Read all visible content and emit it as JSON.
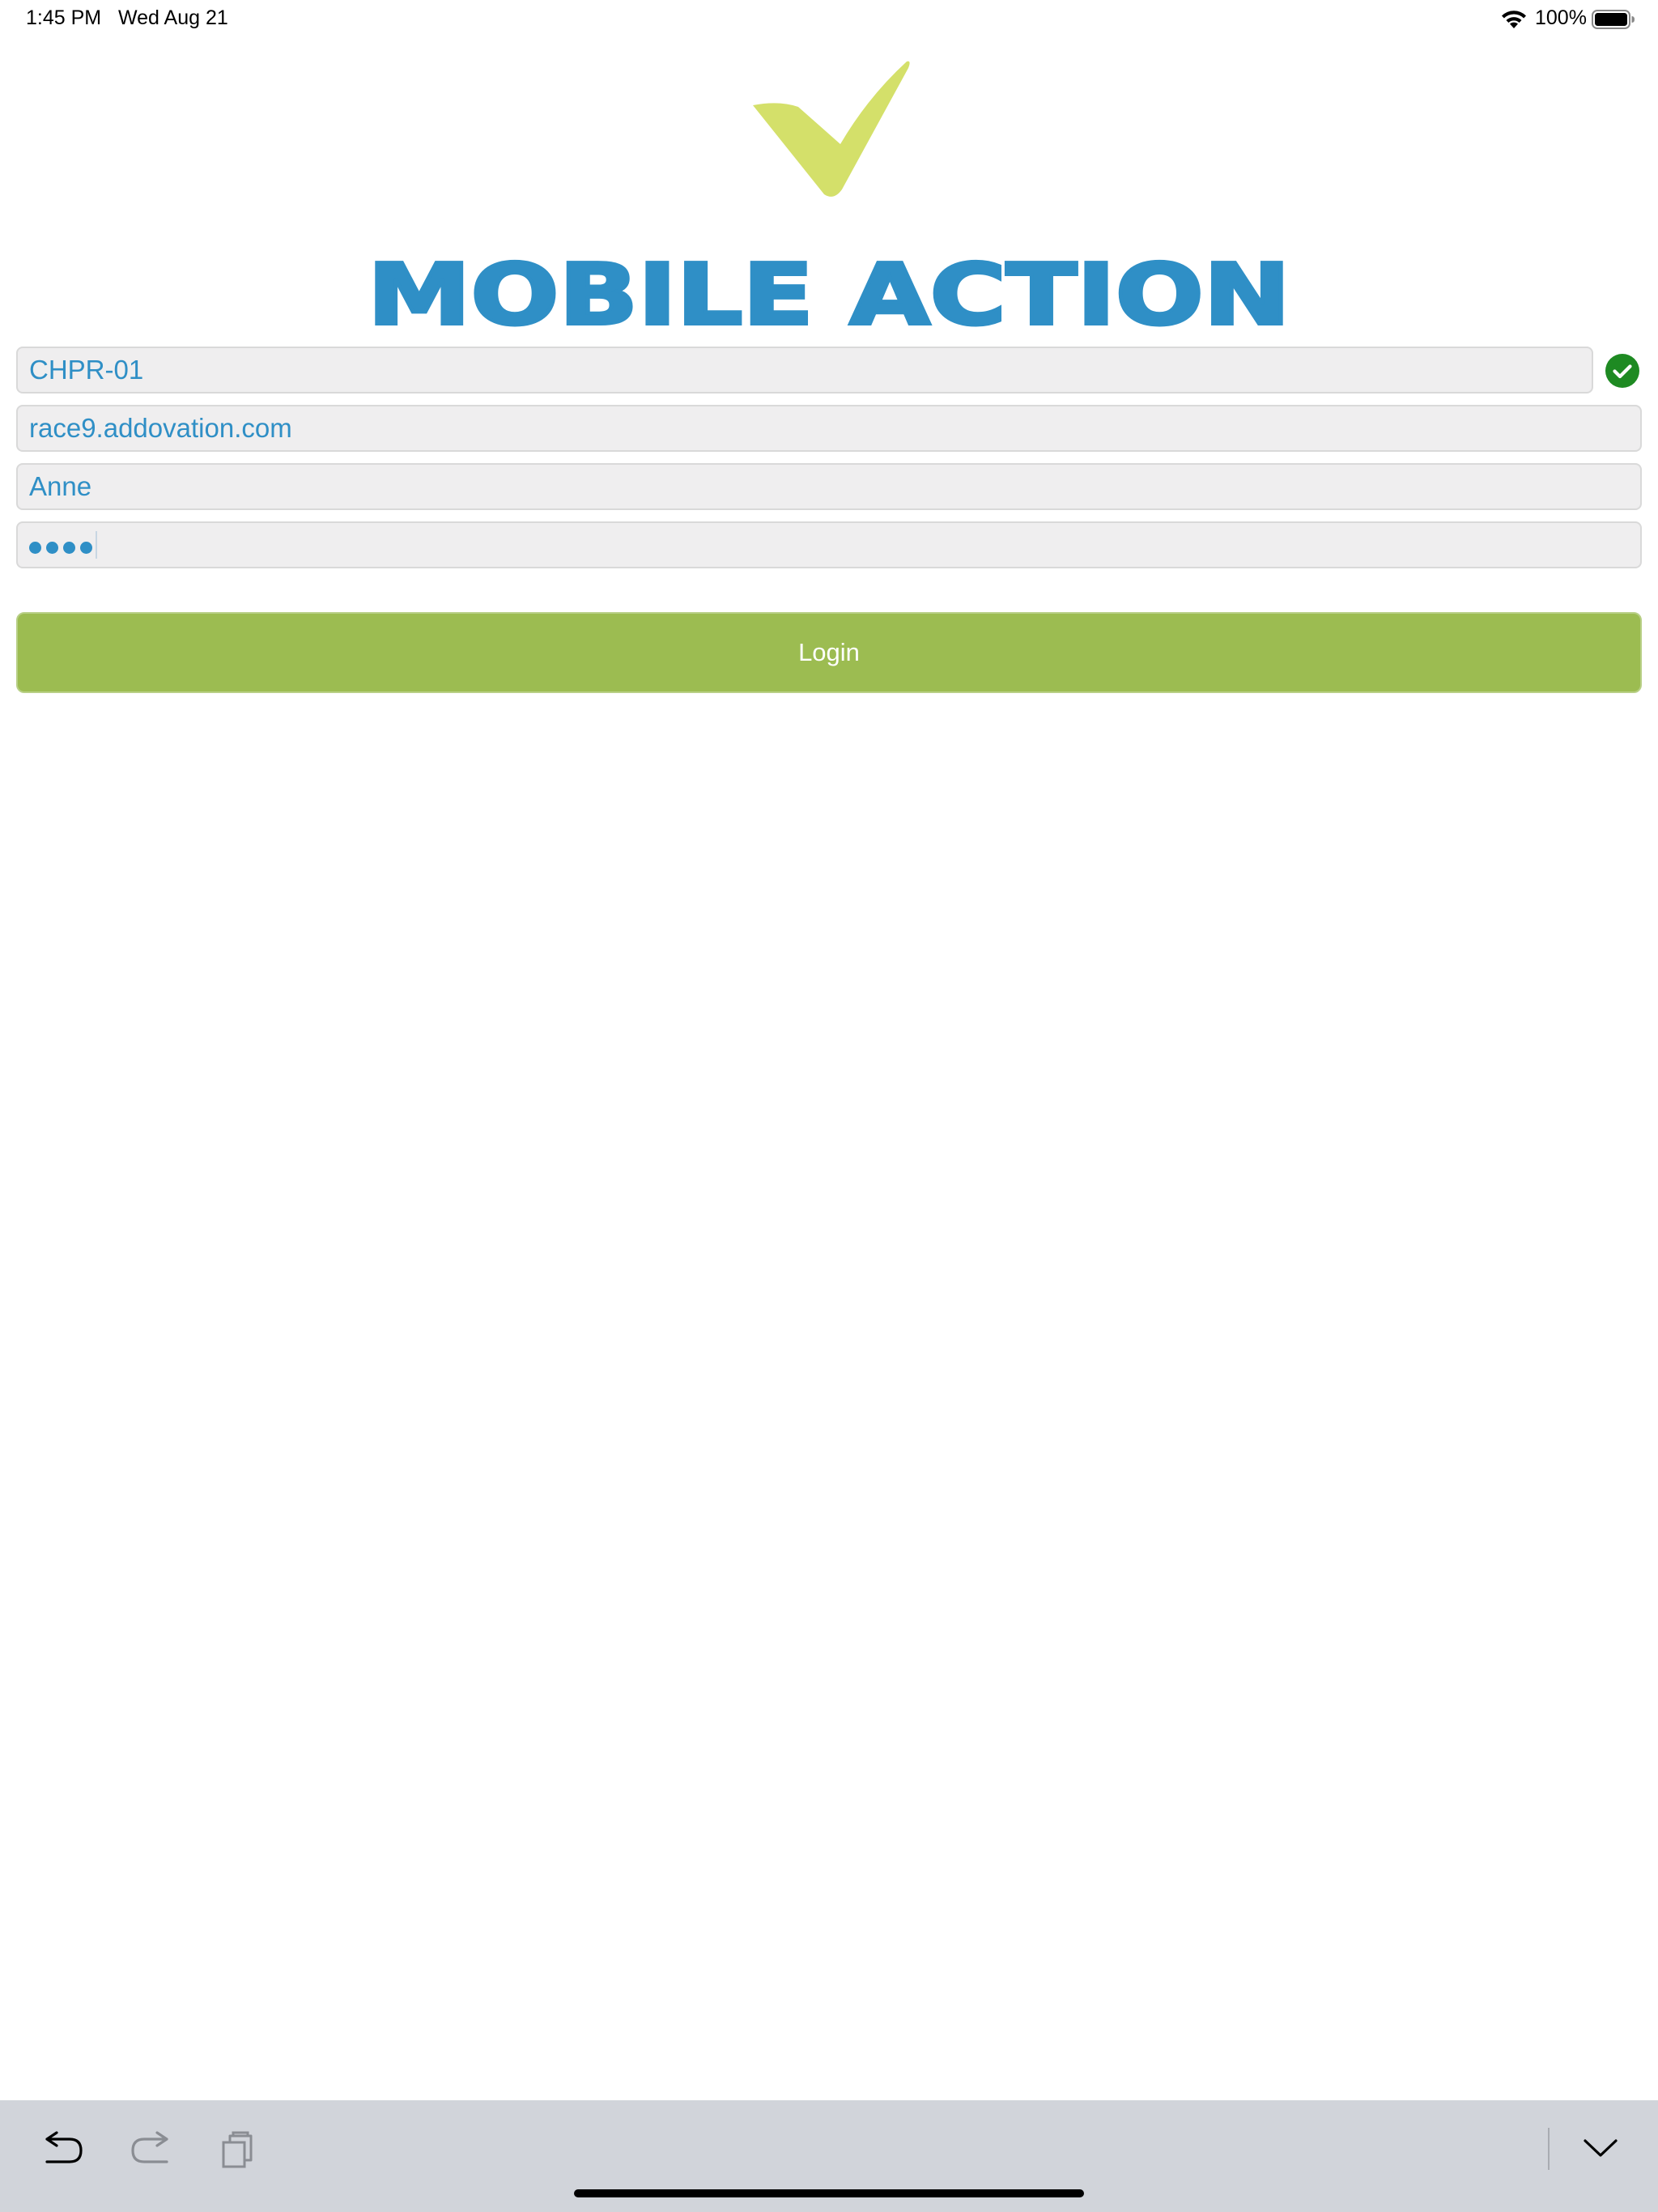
{
  "status_bar": {
    "time": "1:45 PM",
    "date": "Wed Aug 21",
    "battery_percent": "100%",
    "icons": [
      "wifi-icon",
      "battery-icon"
    ]
  },
  "logo": {
    "wordmark": "MOBILE ACTION",
    "check_color": "#d4e06a",
    "wordmark_color": "#2f8fc6"
  },
  "form": {
    "company": "CHPR-01",
    "company_valid": true,
    "server": "race9.addovation.com",
    "username": "Anne",
    "password_length": 4,
    "valid_icon_color": "#1e8a22",
    "text_color": "#2f8fc6"
  },
  "login": {
    "label": "Login",
    "color": "#9cbc51"
  },
  "keyboard_toolbar": {
    "icons": [
      "undo-icon",
      "redo-icon",
      "paste-icon",
      "dismiss-keyboard-icon"
    ]
  }
}
